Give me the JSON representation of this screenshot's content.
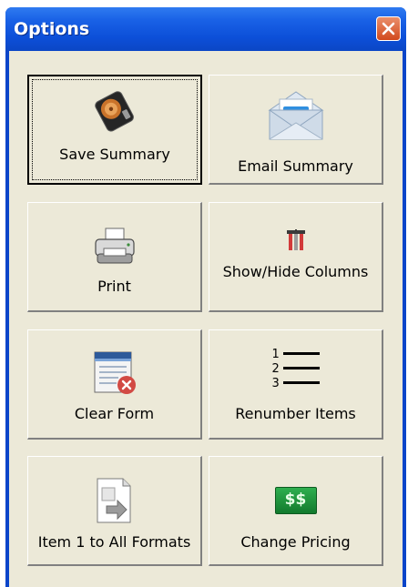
{
  "window": {
    "title": "Options"
  },
  "buttons": {
    "save_summary": "Save Summary",
    "email_summary": "Email Summary",
    "print": "Print",
    "show_hide_columns": "Show/Hide Columns",
    "clear_form": "Clear Form",
    "renumber_items": "Renumber Items",
    "item1_to_all": "Item 1 to All Formats",
    "change_pricing": "Change Pricing"
  },
  "icons": {
    "save_summary": "hard-drive-icon",
    "email_summary": "envelope-icon",
    "print": "printer-icon",
    "show_hide_columns": "columns-icon",
    "clear_form": "clear-form-icon",
    "renumber_items": "numbered-list-icon",
    "item1_to_all": "copy-document-icon",
    "change_pricing": "money-icon"
  },
  "renumber_icon_numbers": [
    "1",
    "2",
    "3"
  ],
  "pricing_icon_text": "$$",
  "colors": {
    "titlebar": "#0c4fd8",
    "close": "#d2491d",
    "face": "#ece9d8"
  }
}
